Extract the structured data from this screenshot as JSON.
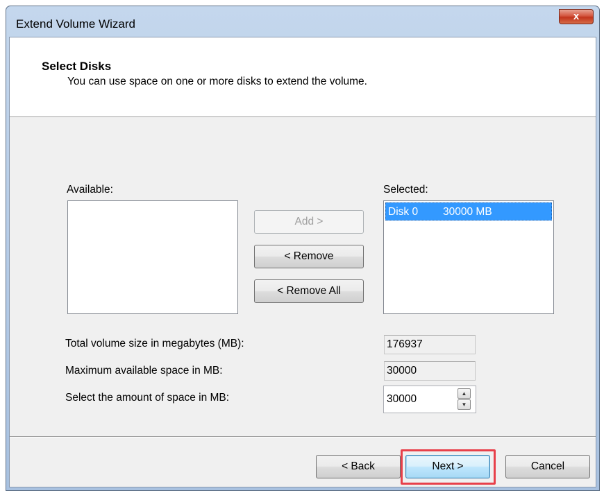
{
  "window": {
    "title": "Extend Volume Wizard",
    "close_label": "x"
  },
  "header": {
    "title": "Select Disks",
    "subtitle": "You can use space on one or more disks to extend the volume."
  },
  "available": {
    "label": "Available:",
    "items": []
  },
  "selected": {
    "label": "Selected:",
    "items": [
      {
        "disk": "Disk 0",
        "size": "30000 MB"
      }
    ]
  },
  "buttons": {
    "add": "Add >",
    "remove": "< Remove",
    "remove_all": "< Remove All",
    "back": "< Back",
    "next": "Next >",
    "cancel": "Cancel"
  },
  "fields": {
    "total_label": "Total volume size in megabytes (MB):",
    "total_value": "176937",
    "max_label": "Maximum available space in MB:",
    "max_value": "30000",
    "amount_label": "Select the amount of space in MB:",
    "amount_value": "30000"
  },
  "icons": {
    "close": "close-icon",
    "spin_up": "spin-up-icon",
    "spin_down": "spin-down-icon"
  },
  "colors": {
    "selection": "#3399ff",
    "highlight_box": "#e8404a"
  }
}
